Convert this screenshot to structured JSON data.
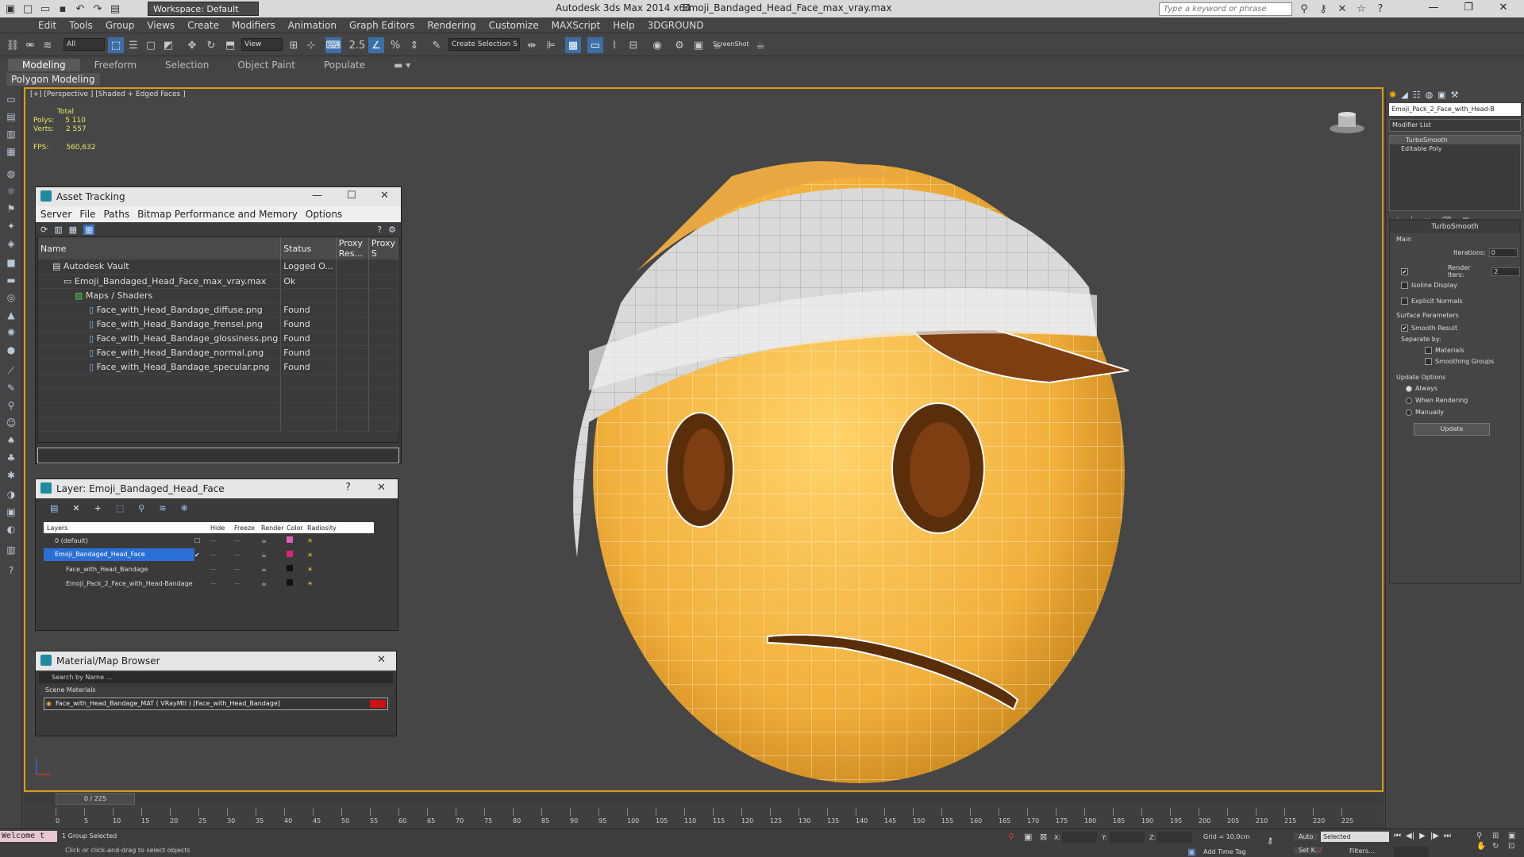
{
  "titlebar": {
    "workspace": "Workspace: Default",
    "app_title": "Autodesk 3ds Max  2014 x64",
    "file_title": "Emoji_Bandaged_Head_Face_max_vray.max",
    "search_placeholder": "Type a keyword or phrase"
  },
  "menu": [
    "Edit",
    "Tools",
    "Group",
    "Views",
    "Create",
    "Modifiers",
    "Animation",
    "Graph Editors",
    "Rendering",
    "Customize",
    "MAXScript",
    "Help",
    "3DGROUND"
  ],
  "toolbar": {
    "selection_filter": "All",
    "ref_coord": "View",
    "named_sel": "Create Selection S",
    "screenshot_label": "ScreenShot"
  },
  "ribbon": {
    "tabs": [
      "Modeling",
      "Freeform",
      "Selection",
      "Object Paint",
      "Populate"
    ],
    "active_tab": "Modeling",
    "sub_label": "Polygon Modeling"
  },
  "viewport": {
    "label": "[+] [Perspective ] [Shaded + Edged Faces ]",
    "stats": {
      "total_label": "Total",
      "polys_label": "Polys:",
      "polys": "5 110",
      "verts_label": "Verts:",
      "verts": "2 557",
      "fps_label": "FPS:",
      "fps": "560,632"
    }
  },
  "asset_tracking": {
    "title": "Asset Tracking",
    "menu": [
      "Server",
      "File",
      "Paths",
      "Bitmap Performance and Memory",
      "Options"
    ],
    "columns": [
      "Name",
      "Status",
      "Proxy Res...",
      "Proxy S"
    ],
    "rows": [
      {
        "name": "Autodesk Vault",
        "status": "Logged O...",
        "indent": 1
      },
      {
        "name": "Emoji_Bandaged_Head_Face_max_vray.max",
        "status": "Ok",
        "indent": 2
      },
      {
        "name": "Maps / Shaders",
        "status": "",
        "indent": 3
      },
      {
        "name": "Face_with_Head_Bandage_diffuse.png",
        "status": "Found",
        "indent": 4
      },
      {
        "name": "Face_with_Head_Bandage_frensel.png",
        "status": "Found",
        "indent": 4
      },
      {
        "name": "Face_with_Head_Bandage_glossiness.png",
        "status": "Found",
        "indent": 4
      },
      {
        "name": "Face_with_Head_Bandage_normal.png",
        "status": "Found",
        "indent": 4
      },
      {
        "name": "Face_with_Head_Bandage_specular.png",
        "status": "Found",
        "indent": 4
      }
    ]
  },
  "layer_panel": {
    "title": "Layer: Emoji_Bandaged_Head_Face",
    "columns": [
      "Layers",
      "Hide",
      "Freeze",
      "Render",
      "Color",
      "Radiosity"
    ],
    "rows": [
      {
        "name": "0 (default)",
        "color": "#e060c0",
        "selected": false
      },
      {
        "name": "Emoji_Bandaged_Head_Face",
        "color": "#e02080",
        "selected": true
      },
      {
        "name": "Face_with_Head_Bandage",
        "color": "#111111",
        "selected": false
      },
      {
        "name": "Emoji_Pack_2_Face_with_Head-Bandage",
        "color": "#111111",
        "selected": false
      }
    ]
  },
  "material_browser": {
    "title": "Material/Map Browser",
    "search_placeholder": "Search by Name ...",
    "section": "Scene Materials",
    "item": "Face_with_Head_Bandage_MAT ( VRayMtl ) [Face_with_Head_Bandage]"
  },
  "command_panel": {
    "object_name": "Emoji_Pack_2_Face_with_Head-B",
    "modifier_list": "Modifier List",
    "stack": [
      "TurboSmooth",
      "Editable Poly"
    ],
    "rollout_title": "TurboSmooth",
    "main_label": "Main",
    "iterations_label": "Iterations:",
    "iterations": "0",
    "render_iters_label": "Render Iters:",
    "render_iters": "2",
    "isoline": "Isoline Display",
    "explicit": "Explicit Normals",
    "surface_label": "Surface Parameters",
    "smooth_result": "Smooth Result",
    "separate_by": "Separate by:",
    "materials": "Materials",
    "smoothing_groups": "Smoothing Groups",
    "update_label": "Update Options",
    "always": "Always",
    "when_rendering": "When Rendering",
    "manually": "Manually",
    "update_button": "Update"
  },
  "timeline": {
    "frame": "0 / 225",
    "ticks": [
      "0",
      "5",
      "10",
      "15",
      "20",
      "25",
      "30",
      "35",
      "40",
      "45",
      "50",
      "55",
      "60",
      "65",
      "70",
      "75",
      "80",
      "85",
      "90",
      "95",
      "100",
      "105",
      "110",
      "115",
      "120",
      "125",
      "130",
      "135",
      "140",
      "145",
      "150",
      "155",
      "160",
      "165",
      "170",
      "175",
      "180",
      "185",
      "190",
      "195",
      "200",
      "205",
      "210",
      "215",
      "220",
      "225"
    ]
  },
  "status": {
    "welcome": "Welcome t",
    "selected": "1 Group Selected",
    "hint": "Click or click-and-drag to select objects",
    "x_label": "X:",
    "y_label": "Y:",
    "z_label": "Z:",
    "grid": "Grid = 10,0cm",
    "add_time_tag": "Add Time Tag",
    "auto": "Auto",
    "selected_set": "Selected",
    "set_k": "Set K.",
    "filters": "Filters..."
  }
}
